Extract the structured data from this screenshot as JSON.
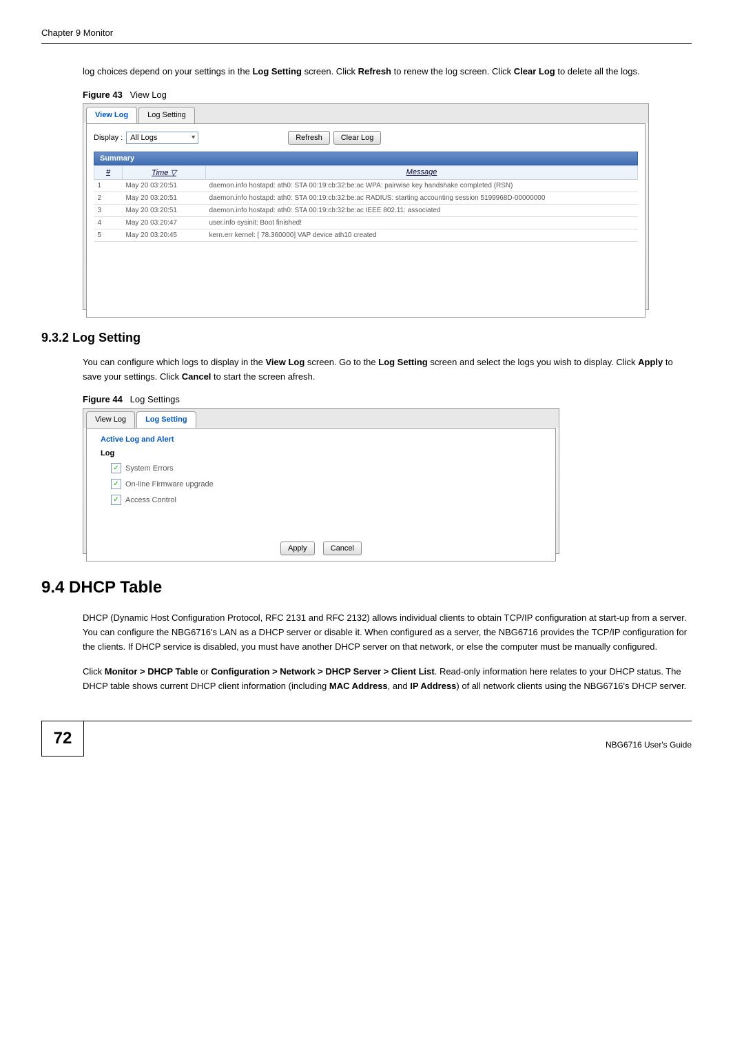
{
  "header": {
    "chapter": "Chapter 9 Monitor"
  },
  "intro_text": {
    "line1_pre": "log choices depend on your settings in the ",
    "log_setting": "Log Setting",
    "line1_mid": " screen. Click ",
    "refresh": "Refresh",
    "line1_post": " to renew the log screen. Click ",
    "clear_log": "Clear Log",
    "line1_end": " to delete all the logs."
  },
  "figure43": {
    "label": "Figure 43",
    "caption": "View Log",
    "tabs": {
      "view_log": "View Log",
      "log_setting": "Log Setting"
    },
    "display_label": "Display :",
    "display_value": "All Logs",
    "refresh_btn": "Refresh",
    "clear_btn": "Clear Log",
    "summary": "Summary",
    "col_num": "#",
    "col_time": "Time ▽",
    "col_message": "Message",
    "rows": [
      {
        "n": "1",
        "t": "May 20 03:20:51",
        "m": "daemon.info hostapd: ath0: STA 00:19:cb:32:be:ac WPA: pairwise key handshake completed (RSN)"
      },
      {
        "n": "2",
        "t": "May 20 03:20:51",
        "m": "daemon.info hostapd: ath0: STA 00:19:cb:32:be:ac RADIUS: starting accounting session 5199968D-00000000"
      },
      {
        "n": "3",
        "t": "May 20 03:20:51",
        "m": "daemon.info hostapd: ath0: STA 00:19:cb:32:be:ac IEEE 802.11: associated"
      },
      {
        "n": "4",
        "t": "May 20 03:20:47",
        "m": "user.info sysinit: Boot finished!"
      },
      {
        "n": "5",
        "t": "May 20 03:20:45",
        "m": "kern.err kernel: [ 78.360000] VAP device ath10 created"
      }
    ]
  },
  "section932": {
    "heading": "9.3.2  Log Setting",
    "p1_pre": "You can configure which logs to display in the ",
    "view_log": "View Log",
    "p1_mid": " screen. Go to the ",
    "log_setting": "Log Setting",
    "p1_mid2": " screen and select the logs you wish to display. Click ",
    "apply": "Apply",
    "p1_mid3": " to save your settings. Click ",
    "cancel": "Cancel",
    "p1_end": " to start the screen afresh."
  },
  "figure44": {
    "label": "Figure 44",
    "caption": "Log Settings",
    "tabs": {
      "view_log": "View Log",
      "log_setting": "Log Setting"
    },
    "panel_title": "Active Log and Alert",
    "log_label": "Log",
    "check1": "System Errors",
    "check2": "On-line Firmware upgrade",
    "check3": "Access Control",
    "apply_btn": "Apply",
    "cancel_btn": "Cancel"
  },
  "section94": {
    "heading": "9.4  DHCP Table",
    "p1": "DHCP (Dynamic Host Configuration Protocol, RFC 2131 and RFC 2132) allows individual clients to obtain TCP/IP configuration at start-up from a server. You can configure the NBG6716's LAN as a DHCP server or disable it. When configured as a server, the NBG6716 provides the TCP/IP configuration for the clients. If DHCP service is disabled, you must have another DHCP server on that network, or else the computer must be manually configured.",
    "p2_pre": "Click ",
    "p2_b1": "Monitor > DHCP Table",
    "p2_mid1": " or ",
    "p2_b2": "Configuration > Network > DHCP Server > Client List",
    "p2_mid2": ". Read-only information here relates to your DHCP status. The DHCP table shows current DHCP client information (including ",
    "p2_b3": "MAC Address",
    "p2_mid3": ", and ",
    "p2_b4": "IP Address",
    "p2_end": ") of all network clients using the NBG6716's DHCP server."
  },
  "footer": {
    "page": "72",
    "guide": "NBG6716 User's Guide"
  }
}
